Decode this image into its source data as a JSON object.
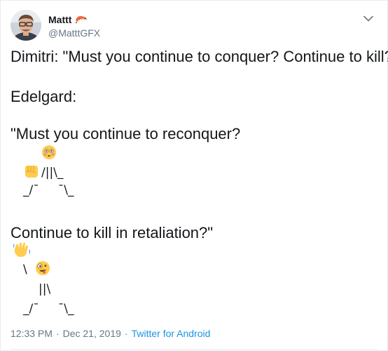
{
  "author": {
    "display_name": "Mattt",
    "name_emoji": "shrimp-emoji",
    "handle": "@MatttGFX",
    "avatar": "profile-photo"
  },
  "menu_icon": "chevron-down-icon",
  "tweet": {
    "lines": [
      "Dimitri: \"Must you continue to conquer? Continue to kill?\"",
      "Edelgard:",
      "\"Must you continue to reconquer?",
      "Continue to kill in retaliation?\""
    ],
    "art1": {
      "emoji_top": "flushed-face-emoji",
      "emoji_left": "oncoming-fist-emoji",
      "row1": "/||\\_",
      "row2": "_/¯     ¯\\_"
    },
    "art2": {
      "emoji_top": "waving-hand-emoji",
      "emoji_face": "zany-face-emoji",
      "row1": "\\",
      "row2": "||\\",
      "row3": "_/¯     ¯\\_"
    }
  },
  "meta": {
    "time": "12:33 PM",
    "separator": "·",
    "date": "Dec 21, 2019",
    "source": "Twitter for Android"
  },
  "colors": {
    "text": "#14171a",
    "secondary": "#657786",
    "link": "#1b95e0",
    "border": "#e6ecf0"
  }
}
